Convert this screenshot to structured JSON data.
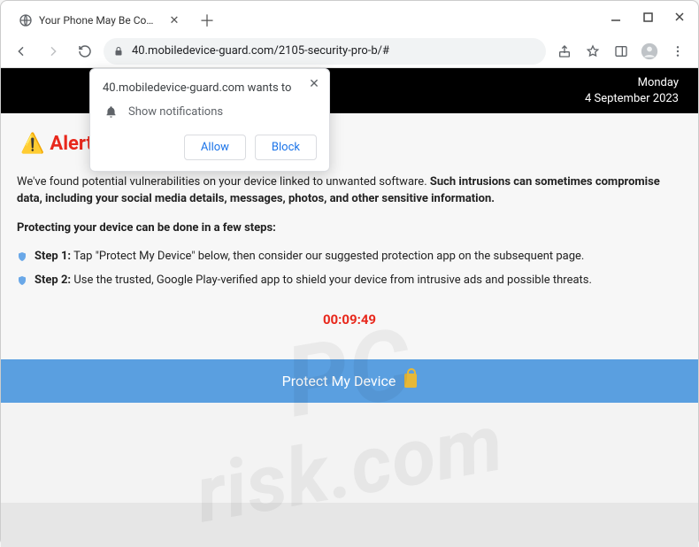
{
  "window": {
    "tab_title": "Your Phone May Be Compromise",
    "url": "40.mobiledevice-guard.com/2105-security-pro-b/#"
  },
  "date_bar": {
    "weekday": "Monday",
    "date": "4 September 2023"
  },
  "alert": {
    "heading": "Alert",
    "intro_plain": "We've found potential vulnerabilities on your device linked to unwanted software. ",
    "intro_bold": "Such intrusions can sometimes compromise data, including your social media details, messages, photos, and other sensitive information.",
    "subhead": "Protecting your device can be done in a few steps:",
    "step1_label": "Step 1:",
    "step1_text": " Tap \"Protect My Device\" below, then consider our suggested protection app on the subsequent page.",
    "step2_label": "Step 2:",
    "step2_text": " Use the trusted, Google Play-verified app to shield your device from intrusive ads and possible threats.",
    "timer": "00:09:49",
    "cta_label": "Protect My Device"
  },
  "notification": {
    "origin_wants_to": "40.mobiledevice-guard.com wants to",
    "permission_label": "Show notifications",
    "allow": "Allow",
    "block": "Block"
  },
  "watermark": {
    "line1": "PC",
    "line2": "risk.com"
  }
}
